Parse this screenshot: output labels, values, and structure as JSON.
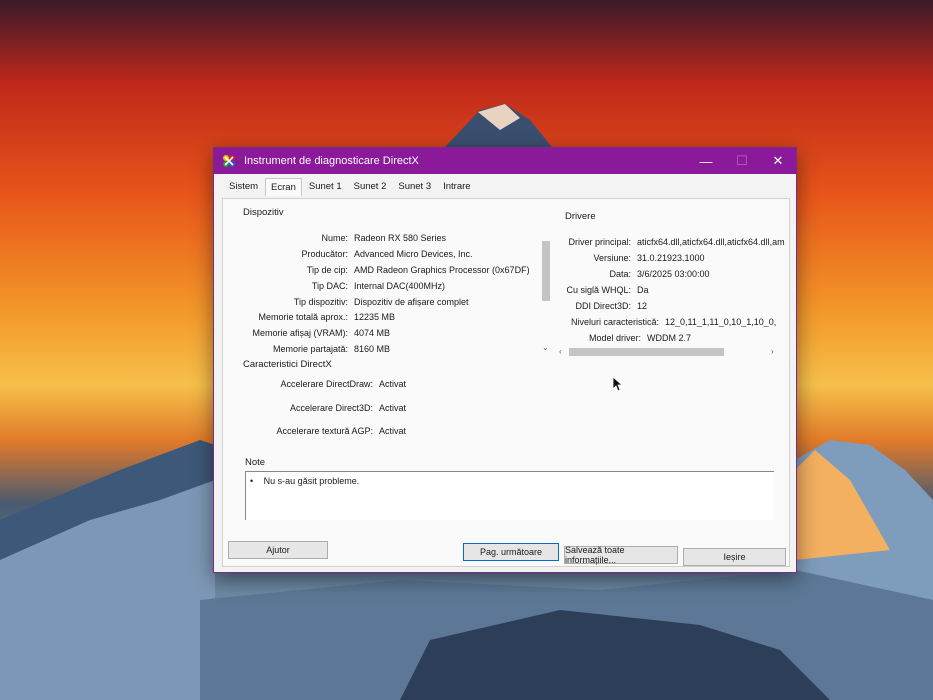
{
  "window": {
    "title": "Instrument de diagnosticare DirectX",
    "accent_color": "#8a1a9a",
    "controls": {
      "minimize": "—",
      "maximize": "☐",
      "close": "✕"
    }
  },
  "tabs": [
    {
      "label": "Sistem"
    },
    {
      "label": "Ecran"
    },
    {
      "label": "Sunet 1"
    },
    {
      "label": "Sunet 2"
    },
    {
      "label": "Sunet 3"
    },
    {
      "label": "Intrare"
    }
  ],
  "active_tab": "Ecran",
  "device": {
    "section_title": "Dispozitiv",
    "fields": [
      {
        "label": "Nume:",
        "value": "Radeon RX 580 Series"
      },
      {
        "label": "Producător:",
        "value": "Advanced Micro Devices, Inc."
      },
      {
        "label": "Tip de cip:",
        "value": "AMD Radeon Graphics Processor (0x67DF)"
      },
      {
        "label": "Tip DAC:",
        "value": "Internal DAC(400MHz)"
      },
      {
        "label": "Tip dispozitiv:",
        "value": "Dispozitiv de afișare complet"
      },
      {
        "label": "Memorie totală aprox.:",
        "value": "12235 MB"
      },
      {
        "label": "Memorie afișaj (VRAM):",
        "value": "4074 MB"
      },
      {
        "label": "Memorie partajată:",
        "value": "8160 MB"
      }
    ]
  },
  "drivers": {
    "section_title": "Drivere",
    "fields": [
      {
        "label": "Driver principal:",
        "value": "aticfx64.dll,aticfx64.dll,aticfx64.dll,am"
      },
      {
        "label": "Versiune:",
        "value": "31.0.21923.1000"
      },
      {
        "label": "Data:",
        "value": "3/6/2025 03:00:00"
      },
      {
        "label": "Cu siglă WHQL:",
        "value": "Da"
      },
      {
        "label": "DDI Direct3D:",
        "value": "12"
      },
      {
        "label": "Niveluri caracteristică:",
        "value": "12_0,11_1,11_0,10_1,10_0,"
      },
      {
        "label": "Model driver:",
        "value": "WDDM 2.7"
      }
    ]
  },
  "directx": {
    "section_title": "Caracteristici DirectX",
    "fields": [
      {
        "label": "Accelerare DirectDraw:",
        "value": "Activat"
      },
      {
        "label": "Accelerare Direct3D:",
        "value": "Activat"
      },
      {
        "label": "Accelerare textură AGP:",
        "value": "Activat"
      }
    ]
  },
  "notes": {
    "section_title": "Note",
    "items": [
      "Nu s-au găsit probleme."
    ]
  },
  "buttons": {
    "help": "Ajutor",
    "next_page": "Pag. următoare",
    "save_all": "Salvează toate informațiile...",
    "exit": "Ieșire"
  }
}
